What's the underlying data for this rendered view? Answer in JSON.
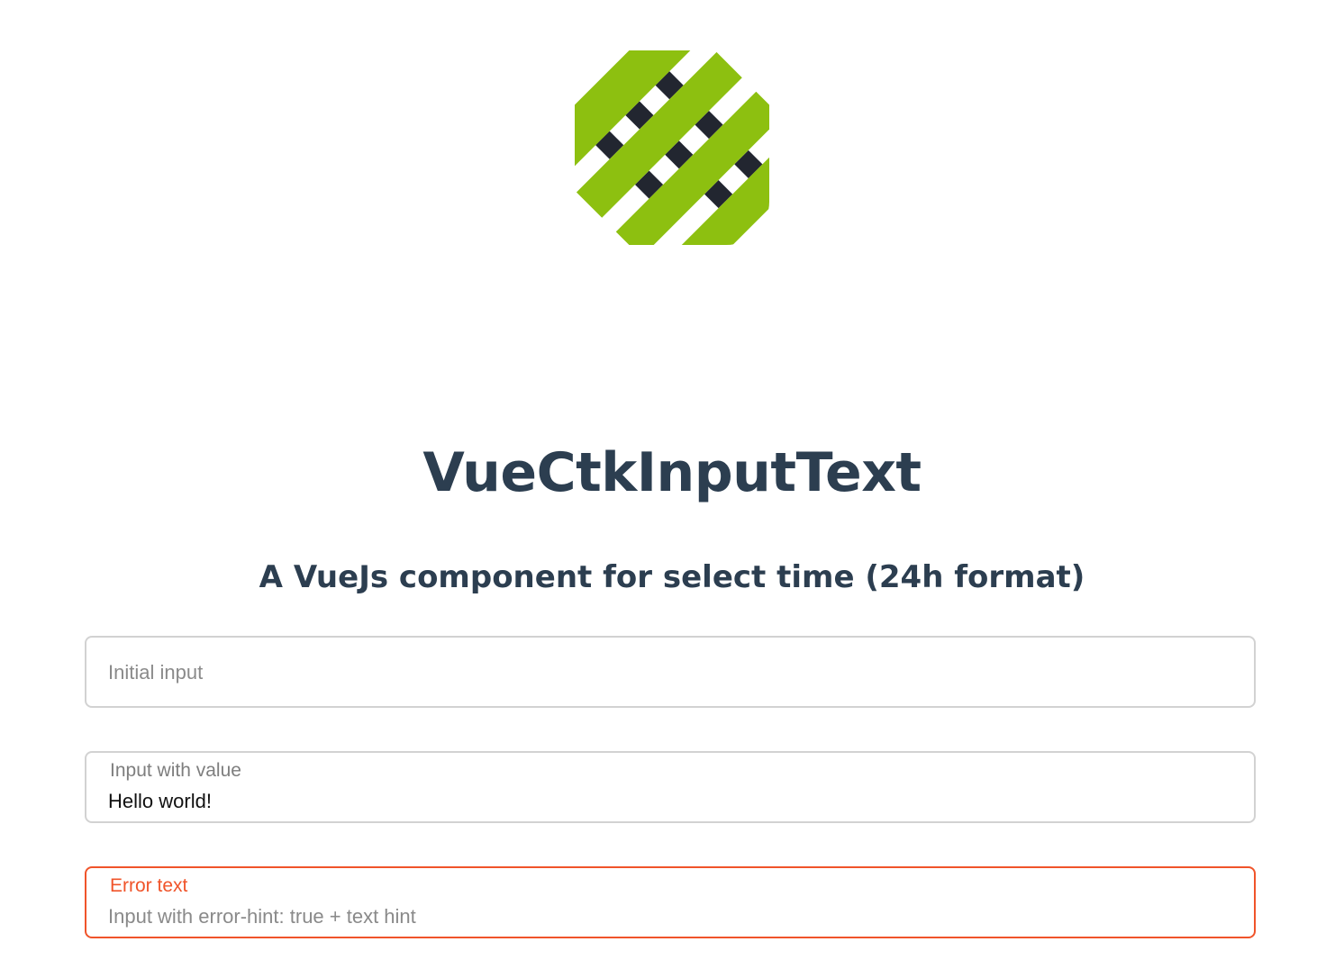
{
  "header": {
    "logo": {
      "icon": "vue-ctk-logo",
      "colors": {
        "green": "#8dc010",
        "dark": "#222630"
      }
    },
    "title": "VueCtkInputText",
    "subtitle": "A VueJs component for select time (24h format)"
  },
  "fields": {
    "initial": {
      "label": "",
      "value": "",
      "placeholder": "Initial input"
    },
    "with_value": {
      "label": "Input with value",
      "value": "Hello world!",
      "placeholder": ""
    },
    "error": {
      "label": "Error text",
      "value": "",
      "placeholder": "Input with error-hint: true + text hint"
    }
  },
  "colors": {
    "text": "#2c3e50",
    "border": "#d2d2d2",
    "error": "#f0542a",
    "label": "#7e7e7e"
  }
}
